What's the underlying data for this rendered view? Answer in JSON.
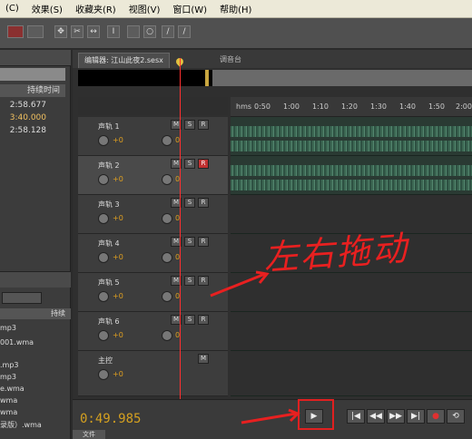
{
  "menu": [
    "(C)",
    "效果(S)",
    "收藏夹(R)",
    "视图(V)",
    "窗口(W)",
    "帮助(H)"
  ],
  "left": {
    "header": "持续时间",
    "times": [
      "2:58.677",
      "3:40.000",
      "2:58.128"
    ],
    "col2": "持续",
    "files": [
      "mp3",
      "001.wma",
      ".mp3",
      "mp3",
      "e.wma",
      "wma",
      "wma",
      "录版）.wma"
    ]
  },
  "tabs": {
    "editor": "编辑器: 江山此夜2.sesx",
    "mixer": "调音台"
  },
  "ruler": [
    "hms",
    "0:50",
    "1:00",
    "1:10",
    "1:20",
    "1:30",
    "1:40",
    "1:50",
    "2:00"
  ],
  "tracks": [
    {
      "name": "声轨 1",
      "m": "M",
      "s": "S",
      "r": "R",
      "vol": "+0",
      "pan": "0"
    },
    {
      "name": "声轨 2",
      "m": "M",
      "s": "S",
      "r": "R",
      "vol": "+0",
      "pan": "0"
    },
    {
      "name": "声轨 3",
      "m": "M",
      "s": "S",
      "r": "R",
      "vol": "+0",
      "pan": "0"
    },
    {
      "name": "声轨 4",
      "m": "M",
      "s": "S",
      "r": "R",
      "vol": "+0",
      "pan": "0"
    },
    {
      "name": "声轨 5",
      "m": "M",
      "s": "S",
      "r": "R",
      "vol": "+0",
      "pan": "0"
    },
    {
      "name": "声轨 6",
      "m": "M",
      "s": "S",
      "r": "R",
      "vol": "+0",
      "pan": "0"
    }
  ],
  "master": {
    "name": "主控",
    "m": "M",
    "vol": "+0"
  },
  "transport": {
    "time": "0:49.985",
    "play": "▶",
    "buttons": [
      "|◀",
      "◀◀",
      "▶▶",
      "▶|",
      "●",
      "⟲"
    ]
  },
  "annotation": "左右拖动",
  "bottom_tab": "文件"
}
